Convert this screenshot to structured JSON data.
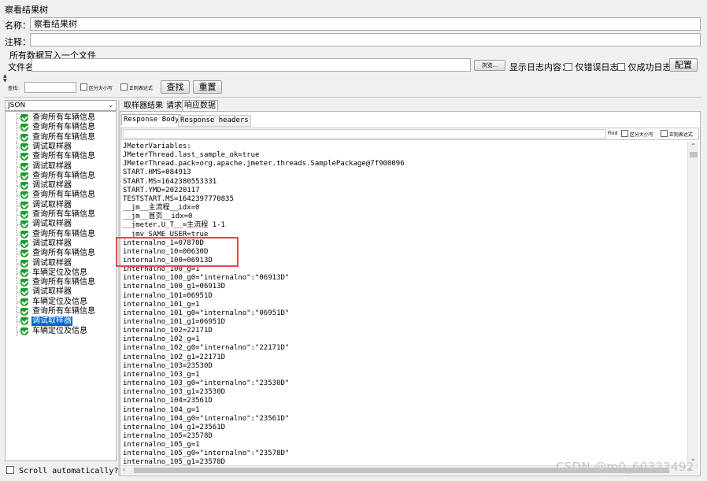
{
  "window": {
    "title": "察看结果树"
  },
  "form": {
    "name_label": "名称：",
    "name_value": "察看结果树",
    "comment_label": "注释：",
    "comment_value": "",
    "section_title": "所有数据写入一个文件",
    "filename_label": "文件名",
    "filename_value": "",
    "browse_label": "浏览...",
    "log_content_label": "显示日志内容：",
    "errors_only_label": "仅错误日志",
    "success_only_label": "仅成功日志",
    "configure_label": "配置"
  },
  "search": {
    "label": "查找:",
    "value": "",
    "case_sensitive_label": "区分大小写",
    "regex_label": "正则表达式",
    "find_button": "查找",
    "reset_button": "重置"
  },
  "renderer": {
    "selected": "JSON",
    "arrow_icon": "chevron-down-icon"
  },
  "tree": {
    "items": [
      {
        "label": "查询所有车辆信息",
        "selected": false
      },
      {
        "label": "查询所有车辆信息",
        "selected": false
      },
      {
        "label": "查询所有车辆信息",
        "selected": false
      },
      {
        "label": "调试取样器",
        "selected": false
      },
      {
        "label": "查询所有车辆信息",
        "selected": false
      },
      {
        "label": "调试取样器",
        "selected": false
      },
      {
        "label": "查询所有车辆信息",
        "selected": false
      },
      {
        "label": "调试取样器",
        "selected": false
      },
      {
        "label": "查询所有车辆信息",
        "selected": false
      },
      {
        "label": "调试取样器",
        "selected": false
      },
      {
        "label": "查询所有车辆信息",
        "selected": false
      },
      {
        "label": "调试取样器",
        "selected": false
      },
      {
        "label": "查询所有车辆信息",
        "selected": false
      },
      {
        "label": "调试取样器",
        "selected": false
      },
      {
        "label": "查询所有车辆信息",
        "selected": false
      },
      {
        "label": "调试取样器",
        "selected": false
      },
      {
        "label": "车辆定位及信息",
        "selected": false
      },
      {
        "label": "查询所有车辆信息",
        "selected": false
      },
      {
        "label": "调试取样器",
        "selected": false
      },
      {
        "label": "车辆定位及信息",
        "selected": false
      },
      {
        "label": "查询所有车辆信息",
        "selected": false
      },
      {
        "label": "调试取样器",
        "selected": true
      },
      {
        "label": "车辆定位及信息",
        "selected": false
      }
    ],
    "scroll_auto_label": "Scroll automatically?"
  },
  "tabs": {
    "main": [
      "取样器结果",
      "请求",
      "响应数据"
    ],
    "main_active": 2,
    "sub": [
      "Response Body",
      "Response headers"
    ],
    "sub_active": 0
  },
  "response_find": {
    "find_label": "Find",
    "case_label": "区分大小写",
    "regex_label": "正则表达式"
  },
  "response": {
    "lines": [
      "JMeterVariables:",
      "JMeterThread.last_sample_ok=true",
      "JMeterThread.pack=org.apache.jmeter.threads.SamplePackage@7f900096",
      "START.HMS=084913",
      "START.MS=1642380553331",
      "START.YMD=20220117",
      "TESTSTART.MS=1642397770835",
      "__jm__主流程__idx=0",
      "__jm__首页__idx=0",
      "__jmeter.U_T__=主流程 1-1",
      "__jmv_SAME_USER=true",
      "internalno_1=07870D",
      "internalno_10=00630D",
      "internalno_100=06913D",
      "internalno_100_g=1",
      "internalno_100_g0=\"internalno\":\"06913D\"",
      "internalno_100_g1=06913D",
      "internalno_101=06951D",
      "internalno_101_g=1",
      "internalno_101_g0=\"internalno\":\"06951D\"",
      "internalno_101_g1=06951D",
      "internalno_102=22171D",
      "internalno_102_g=1",
      "internalno_102_g0=\"internalno\":\"22171D\"",
      "internalno_102_g1=22171D",
      "internalno_103=23530D",
      "internalno_103_g=1",
      "internalno_103_g0=\"internalno\":\"23530D\"",
      "internalno_103_g1=23530D",
      "internalno_104=23561D",
      "internalno_104_g=1",
      "internalno_104_g0=\"internalno\":\"23561D\"",
      "internalno_104_g1=23561D",
      "internalno_105=23578D",
      "internalno_105_g=1",
      "internalno_105_g0=\"internalno\":\"23578D\"",
      "internalno_105_g1=23578D"
    ]
  },
  "watermark": "CSDN @m0_60322492",
  "colors": {
    "selection": "#0a64c8",
    "highlight_box": "#e5484d",
    "pass_icon": "#1e9b2e"
  }
}
